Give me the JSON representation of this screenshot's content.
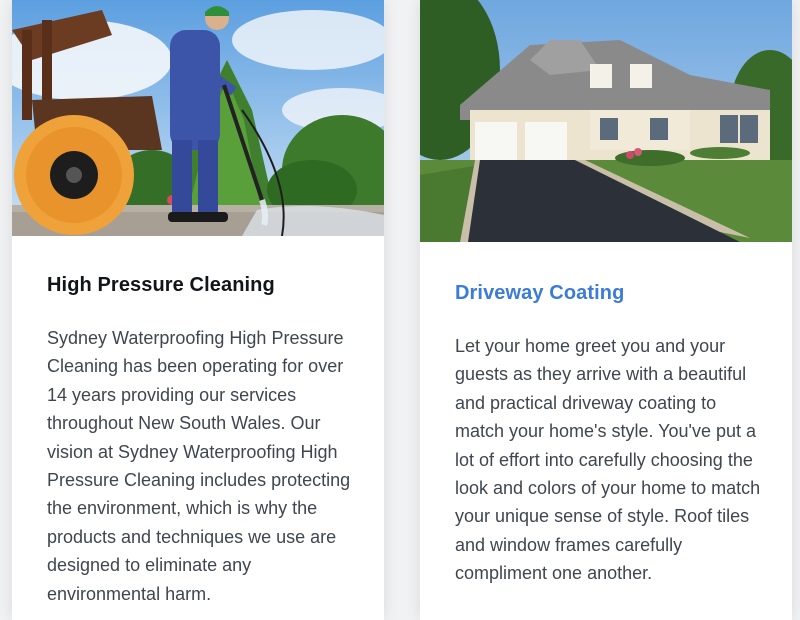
{
  "cards": [
    {
      "title": "High Pressure Cleaning",
      "text": "Sydney Waterproofing High Pressure Cleaning has been operating for over 14 years providing our services throughout New South Wales. Our vision at Sydney Waterproofing High Pressure Cleaning includes protecting the environment, which is why the products and techniques we use are designed to eliminate any environmental harm.",
      "image": "worker-pressure-washing-photo"
    },
    {
      "title": "Driveway Coating",
      "text": "Let your home greet you and your guests as they arrive with a beautiful and practical driveway coating to match your home's style. You've put a lot of effort into carefully choosing the look and colors of your home to match your unique sense of style. Roof tiles and window frames carefully compliment one another.",
      "image": "house-driveway-photo"
    }
  ],
  "colors": {
    "accent_title": "#3b7bd9",
    "dark_title": "#111418",
    "body_text": "#3f4650",
    "page_bg": "#f1f2f4"
  }
}
